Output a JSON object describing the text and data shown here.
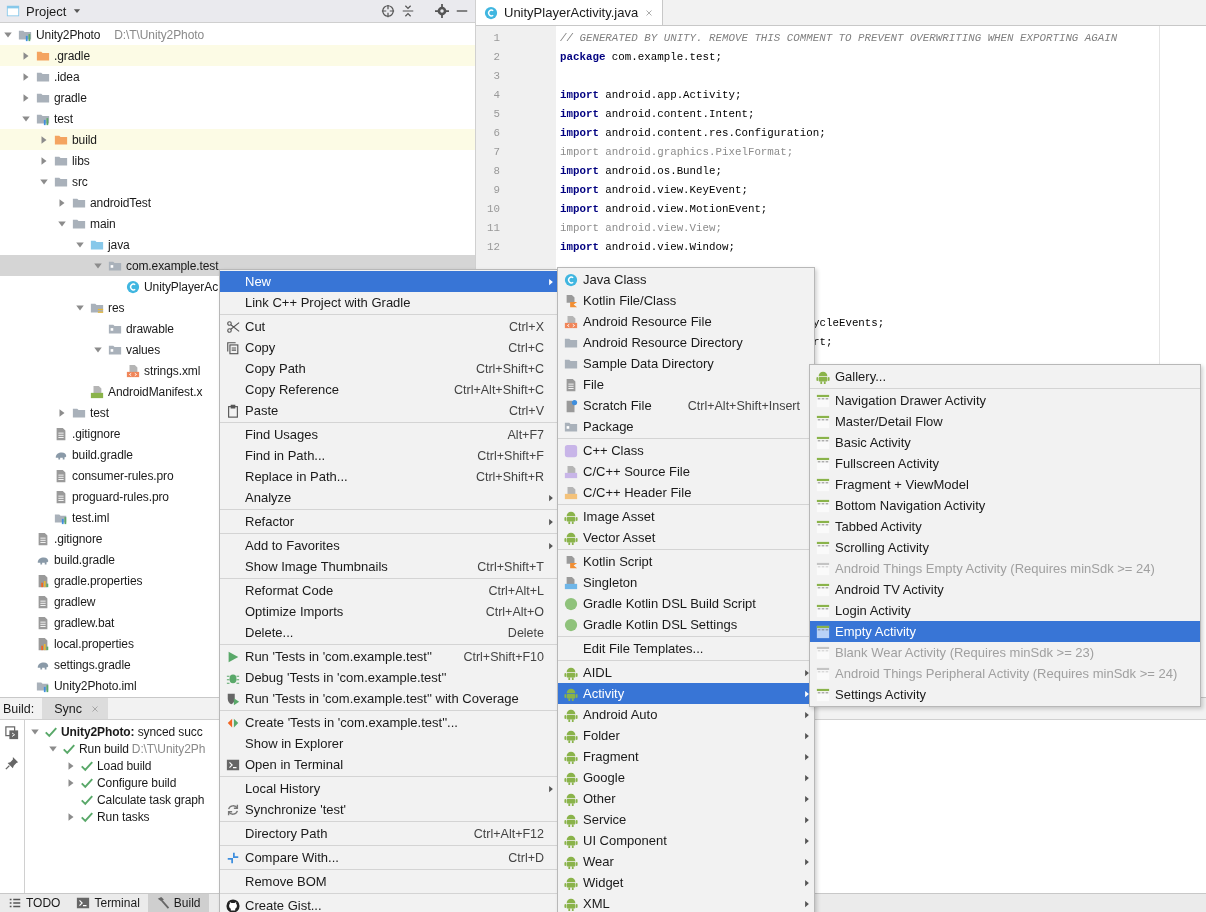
{
  "project_panel": {
    "title": "Project",
    "tree": [
      {
        "label": "Unity2Photo",
        "path": "D:\\T\\Unity2Photo",
        "kind": "module",
        "expanded": true,
        "selected": false,
        "highlighted": false,
        "children": [
          {
            "label": ".gradle",
            "kind": "folder-excluded",
            "expanded": false,
            "selected": false,
            "highlighted": true
          },
          {
            "label": ".idea",
            "kind": "folder",
            "expanded": false,
            "selected": false,
            "highlighted": false
          },
          {
            "label": "gradle",
            "kind": "folder",
            "expanded": false,
            "selected": false,
            "highlighted": false
          },
          {
            "label": "test",
            "kind": "module",
            "expanded": true,
            "selected": false,
            "highlighted": false,
            "children": [
              {
                "label": "build",
                "kind": "folder-excluded",
                "expanded": false,
                "selected": false,
                "highlighted": true
              },
              {
                "label": "libs",
                "kind": "folder",
                "expanded": false,
                "selected": false,
                "highlighted": false
              },
              {
                "label": "src",
                "kind": "folder",
                "expanded": true,
                "selected": false,
                "highlighted": false,
                "children": [
                  {
                    "label": "androidTest",
                    "kind": "folder",
                    "expanded": false,
                    "selected": false,
                    "highlighted": false
                  },
                  {
                    "label": "main",
                    "kind": "folder",
                    "expanded": true,
                    "selected": false,
                    "highlighted": false,
                    "children": [
                      {
                        "label": "java",
                        "kind": "folder-source",
                        "expanded": true,
                        "selected": false,
                        "highlighted": false,
                        "children": [
                          {
                            "label": "com.example.test",
                            "kind": "package",
                            "expanded": true,
                            "selected": true,
                            "highlighted": false,
                            "children": [
                              {
                                "label": "UnityPlayerAc",
                                "kind": "class",
                                "selected": false,
                                "highlighted": false
                              }
                            ]
                          }
                        ]
                      },
                      {
                        "label": "res",
                        "kind": "res",
                        "expanded": true,
                        "selected": false,
                        "highlighted": false,
                        "children": [
                          {
                            "label": "drawable",
                            "kind": "package",
                            "selected": false,
                            "highlighted": false
                          },
                          {
                            "label": "values",
                            "kind": "package",
                            "expanded": true,
                            "selected": false,
                            "highlighted": false,
                            "children": [
                              {
                                "label": "strings.xml",
                                "kind": "xml",
                                "selected": false,
                                "highlighted": false
                              }
                            ]
                          }
                        ]
                      },
                      {
                        "label": "AndroidManifest.x",
                        "kind": "manifest",
                        "selected": false,
                        "highlighted": false
                      }
                    ]
                  },
                  {
                    "label": "test",
                    "kind": "folder",
                    "expanded": false,
                    "selected": false,
                    "highlighted": false
                  }
                ]
              },
              {
                "label": ".gitignore",
                "kind": "file",
                "selected": false,
                "highlighted": false
              },
              {
                "label": "build.gradle",
                "kind": "gradle",
                "selected": false,
                "highlighted": false
              },
              {
                "label": "consumer-rules.pro",
                "kind": "file",
                "selected": false,
                "highlighted": false
              },
              {
                "label": "proguard-rules.pro",
                "kind": "file",
                "selected": false,
                "highlighted": false
              },
              {
                "label": "test.iml",
                "kind": "iml",
                "selected": false,
                "highlighted": false
              }
            ]
          },
          {
            "label": ".gitignore",
            "kind": "file",
            "selected": false,
            "highlighted": false
          },
          {
            "label": "build.gradle",
            "kind": "gradle",
            "selected": false,
            "highlighted": false
          },
          {
            "label": "gradle.properties",
            "kind": "properties",
            "selected": false,
            "highlighted": false
          },
          {
            "label": "gradlew",
            "kind": "file",
            "selected": false,
            "highlighted": false
          },
          {
            "label": "gradlew.bat",
            "kind": "file",
            "selected": false,
            "highlighted": false
          },
          {
            "label": "local.properties",
            "kind": "properties",
            "selected": false,
            "highlighted": false
          },
          {
            "label": "settings.gradle",
            "kind": "gradle",
            "selected": false,
            "highlighted": false
          },
          {
            "label": "Unity2Photo.iml",
            "kind": "iml",
            "selected": false,
            "highlighted": false
          }
        ]
      }
    ]
  },
  "editor": {
    "tabs": [
      {
        "label": "UnityPlayerActivity.java",
        "selected": true
      }
    ],
    "lines": [
      {
        "number": "1",
        "kind": "comment",
        "text": "// GENERATED BY UNITY. REMOVE THIS COMMENT TO PREVENT OVERWRITING WHEN EXPORTING AGAIN"
      },
      {
        "number": "2",
        "kind": "statement",
        "keyword": "package",
        "text": " com.example.test;",
        "unused": false
      },
      {
        "number": "3",
        "kind": "blank"
      },
      {
        "number": "4",
        "kind": "statement",
        "keyword": "import",
        "text": " android.app.Activity;",
        "unused": false
      },
      {
        "number": "5",
        "kind": "statement",
        "keyword": "import",
        "text": " android.content.Intent;",
        "unused": false
      },
      {
        "number": "6",
        "kind": "statement",
        "keyword": "import",
        "text": " android.content.res.Configuration;",
        "unused": false
      },
      {
        "number": "7",
        "kind": "statement",
        "keyword": "import",
        "text": " android.graphics.PixelFormat;",
        "unused": true
      },
      {
        "number": "8",
        "kind": "statement",
        "keyword": "import",
        "text": " android.os.Bundle;",
        "unused": false
      },
      {
        "number": "9",
        "kind": "statement",
        "keyword": "import",
        "text": " android.view.KeyEvent;",
        "unused": false
      },
      {
        "number": "10",
        "kind": "statement",
        "keyword": "import",
        "text": " android.view.MotionEvent;",
        "unused": false
      },
      {
        "number": "11",
        "kind": "statement",
        "keyword": "import",
        "text": " android.view.View;",
        "unused": true
      },
      {
        "number": "12",
        "kind": "statement",
        "keyword": "import",
        "text": " android.view.Window;",
        "unused": false
      }
    ],
    "partial_lines": [
      {
        "text": "ycleEvents;"
      },
      {
        "text": "rt;"
      }
    ]
  },
  "build_panel": {
    "label": "Build:",
    "tabs": [
      {
        "label": "Sync",
        "selected": true
      }
    ],
    "tree": [
      {
        "text": "**Unity2Photo:** synced succ",
        "expanded": true,
        "children": [
          {
            "text": "Run build",
            "path": "D:\\T\\Unity2Ph",
            "expanded": true,
            "children": [
              {
                "text": "Load build",
                "expanded": false
              },
              {
                "text": "Configure build",
                "expanded": false
              },
              {
                "text": "Calculate task graph"
              },
              {
                "text": "Run tasks",
                "expanded": false
              }
            ]
          }
        ]
      }
    ]
  },
  "tool_strip": [
    {
      "label": "TODO",
      "kind": "list",
      "selected": false
    },
    {
      "label": "Terminal",
      "kind": "terminal",
      "selected": false
    },
    {
      "label": "Build",
      "kind": "hammer",
      "selected": true
    }
  ],
  "context_menu": {
    "items": [
      {
        "kind": "plain",
        "label": "New",
        "submenu": true,
        "selected": true
      },
      {
        "kind": "plain",
        "label": "Link C++ Project with Gradle",
        "selected": false
      },
      {
        "kind": "separator"
      },
      {
        "kind": "scissors",
        "label": "Cut",
        "shortcut": "Ctrl+X",
        "selected": false
      },
      {
        "kind": "copy",
        "label": "Copy",
        "shortcut": "Ctrl+C",
        "selected": false
      },
      {
        "kind": "plain",
        "label": "Copy Path",
        "shortcut": "Ctrl+Shift+C",
        "selected": false
      },
      {
        "kind": "plain",
        "label": "Copy Reference",
        "shortcut": "Ctrl+Alt+Shift+C",
        "selected": false
      },
      {
        "kind": "paste",
        "label": "Paste",
        "shortcut": "Ctrl+V",
        "selected": false
      },
      {
        "kind": "separator"
      },
      {
        "kind": "plain",
        "label": "Find Usages",
        "shortcut": "Alt+F7",
        "selected": false
      },
      {
        "kind": "plain",
        "label": "Find in Path...",
        "shortcut": "Ctrl+Shift+F",
        "selected": false
      },
      {
        "kind": "plain",
        "label": "Replace in Path...",
        "shortcut": "Ctrl+Shift+R",
        "selected": false
      },
      {
        "kind": "plain",
        "label": "Analyze",
        "submenu": true,
        "selected": false
      },
      {
        "kind": "separator"
      },
      {
        "kind": "plain",
        "label": "Refactor",
        "submenu": true,
        "selected": false
      },
      {
        "kind": "separator"
      },
      {
        "kind": "plain",
        "label": "Add to Favorites",
        "submenu": true,
        "selected": false
      },
      {
        "kind": "plain",
        "label": "Show Image Thumbnails",
        "shortcut": "Ctrl+Shift+T",
        "selected": false
      },
      {
        "kind": "separator"
      },
      {
        "kind": "plain",
        "label": "Reformat Code",
        "shortcut": "Ctrl+Alt+L",
        "selected": false
      },
      {
        "kind": "plain",
        "label": "Optimize Imports",
        "shortcut": "Ctrl+Alt+O",
        "selected": false
      },
      {
        "kind": "plain",
        "label": "Delete...",
        "shortcut": "Delete",
        "selected": false
      },
      {
        "kind": "separator"
      },
      {
        "kind": "run",
        "label": "Run 'Tests in 'com.example.test''",
        "shortcut": "Ctrl+Shift+F10",
        "selected": false
      },
      {
        "kind": "debug",
        "label": "Debug 'Tests in 'com.example.test''",
        "selected": false
      },
      {
        "kind": "coverage",
        "label": "Run 'Tests in 'com.example.test'' with Coverage",
        "selected": false
      },
      {
        "kind": "separator"
      },
      {
        "kind": "create-test",
        "label": "Create 'Tests in 'com.example.test''...",
        "selected": false
      },
      {
        "kind": "plain",
        "label": "Show in Explorer",
        "selected": false
      },
      {
        "kind": "terminal",
        "label": "Open in Terminal",
        "selected": false
      },
      {
        "kind": "separator"
      },
      {
        "kind": "plain",
        "label": "Local History",
        "submenu": true,
        "selected": false
      },
      {
        "kind": "sync",
        "label": "Synchronize 'test'",
        "selected": false
      },
      {
        "kind": "separator"
      },
      {
        "kind": "plain",
        "label": "Directory Path",
        "shortcut": "Ctrl+Alt+F12",
        "selected": false
      },
      {
        "kind": "separator"
      },
      {
        "kind": "compare",
        "label": "Compare With...",
        "shortcut": "Ctrl+D",
        "selected": false
      },
      {
        "kind": "separator"
      },
      {
        "kind": "plain",
        "label": "Remove BOM",
        "selected": false
      },
      {
        "kind": "separator"
      },
      {
        "kind": "github",
        "label": "Create Gist...",
        "selected": false
      }
    ]
  },
  "new_menu": {
    "items": [
      {
        "kind": "class",
        "label": "Java Class",
        "selected": false
      },
      {
        "kind": "kotlin",
        "label": "Kotlin File/Class",
        "selected": false
      },
      {
        "kind": "xml",
        "label": "Android Resource File",
        "selected": false
      },
      {
        "kind": "folder",
        "label": "Android Resource Directory",
        "selected": false
      },
      {
        "kind": "folder",
        "label": "Sample Data Directory",
        "selected": false
      },
      {
        "kind": "file",
        "label": "File",
        "selected": false
      },
      {
        "kind": "scratch",
        "label": "Scratch File",
        "shortcut": "Ctrl+Alt+Shift+Insert",
        "selected": false
      },
      {
        "kind": "package",
        "label": "Package",
        "selected": false
      },
      {
        "kind": "separator"
      },
      {
        "kind": "cpp-class",
        "label": "C++ Class",
        "selected": false
      },
      {
        "kind": "cpp-source",
        "label": "C/C++ Source File",
        "selected": false
      },
      {
        "kind": "cpp-header",
        "label": "C/C++ Header File",
        "selected": false
      },
      {
        "kind": "separator"
      },
      {
        "kind": "android",
        "label": "Image Asset",
        "selected": false
      },
      {
        "kind": "android",
        "label": "Vector Asset",
        "selected": false
      },
      {
        "kind": "separator"
      },
      {
        "kind": "kotlin",
        "label": "Kotlin Script",
        "selected": false
      },
      {
        "kind": "singleton",
        "label": "Singleton",
        "selected": false
      },
      {
        "kind": "gradle-kts",
        "label": "Gradle Kotlin DSL Build Script",
        "selected": false
      },
      {
        "kind": "gradle-kts",
        "label": "Gradle Kotlin DSL Settings",
        "selected": false
      },
      {
        "kind": "separator"
      },
      {
        "kind": "plain",
        "label": "Edit File Templates...",
        "selected": false
      },
      {
        "kind": "separator"
      },
      {
        "kind": "android",
        "label": "AIDL",
        "submenu": true,
        "selected": false
      },
      {
        "kind": "android",
        "label": "Activity",
        "submenu": true,
        "selected": true
      },
      {
        "kind": "android",
        "label": "Android Auto",
        "submenu": true,
        "selected": false
      },
      {
        "kind": "android",
        "label": "Folder",
        "submenu": true,
        "selected": false
      },
      {
        "kind": "android",
        "label": "Fragment",
        "submenu": true,
        "selected": false
      },
      {
        "kind": "android",
        "label": "Google",
        "submenu": true,
        "selected": false
      },
      {
        "kind": "android",
        "label": "Other",
        "submenu": true,
        "selected": false
      },
      {
        "kind": "android",
        "label": "Service",
        "submenu": true,
        "selected": false
      },
      {
        "kind": "android",
        "label": "UI Component",
        "submenu": true,
        "selected": false
      },
      {
        "kind": "android",
        "label": "Wear",
        "submenu": true,
        "selected": false
      },
      {
        "kind": "android",
        "label": "Widget",
        "submenu": true,
        "selected": false
      },
      {
        "kind": "android",
        "label": "XML",
        "submenu": true,
        "selected": false
      }
    ]
  },
  "activity_menu": {
    "items": [
      {
        "kind": "android",
        "label": "Gallery...",
        "selected": false,
        "disabled": false
      },
      {
        "kind": "separator"
      },
      {
        "kind": "template",
        "label": "Navigation Drawer Activity",
        "selected": false,
        "disabled": false
      },
      {
        "kind": "template",
        "label": "Master/Detail Flow",
        "selected": false,
        "disabled": false
      },
      {
        "kind": "template",
        "label": "Basic Activity",
        "selected": false,
        "disabled": false
      },
      {
        "kind": "template",
        "label": "Fullscreen Activity",
        "selected": false,
        "disabled": false
      },
      {
        "kind": "template",
        "label": "Fragment + ViewModel",
        "selected": false,
        "disabled": false
      },
      {
        "kind": "template",
        "label": "Bottom Navigation Activity",
        "selected": false,
        "disabled": false
      },
      {
        "kind": "template",
        "label": "Tabbed Activity",
        "selected": false,
        "disabled": false
      },
      {
        "kind": "template",
        "label": "Scrolling Activity",
        "selected": false,
        "disabled": false
      },
      {
        "kind": "template",
        "label": "Android Things Empty Activity (Requires minSdk >= 24)",
        "selected": false,
        "disabled": true
      },
      {
        "kind": "template",
        "label": "Android TV Activity",
        "selected": false,
        "disabled": false
      },
      {
        "kind": "template",
        "label": "Login Activity",
        "selected": false,
        "disabled": false
      },
      {
        "kind": "template",
        "label": "Empty Activity",
        "selected": true,
        "disabled": false
      },
      {
        "kind": "template",
        "label": "Blank Wear Activity (Requires minSdk >= 23)",
        "selected": false,
        "disabled": true
      },
      {
        "kind": "template",
        "label": "Android Things Peripheral Activity (Requires minSdk >= 24)",
        "selected": false,
        "disabled": true
      },
      {
        "kind": "template",
        "label": "Settings Activity",
        "selected": false,
        "disabled": false
      }
    ]
  }
}
